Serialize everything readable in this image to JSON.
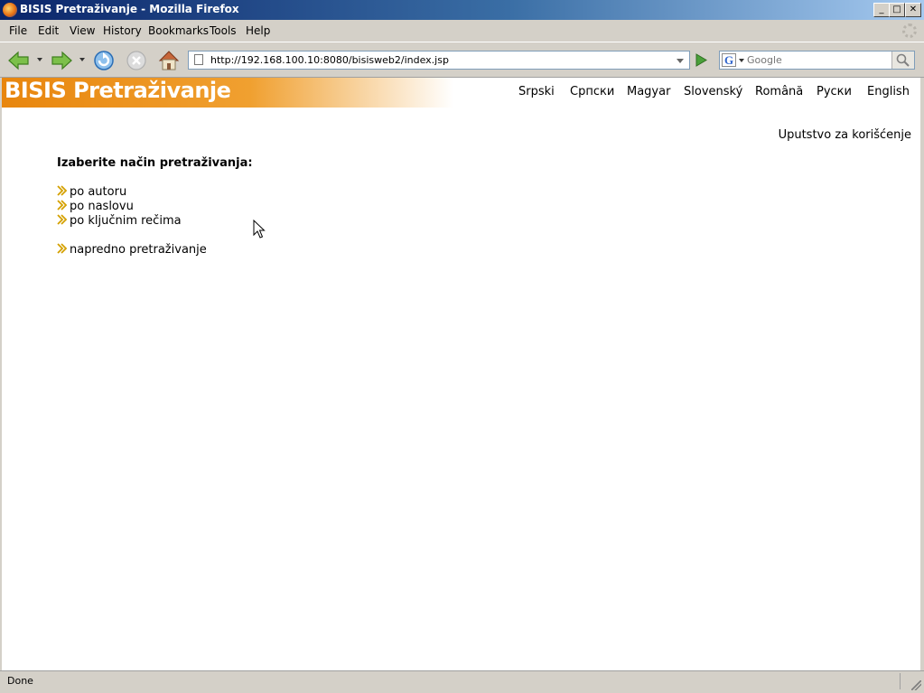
{
  "window": {
    "title": "BISIS Pretraživanje - Mozilla Firefox",
    "controls": {
      "minimize": "_",
      "maximize": "□",
      "close": "✕"
    }
  },
  "menu": {
    "items": [
      {
        "label": "File"
      },
      {
        "label": "Edit"
      },
      {
        "label": "View"
      },
      {
        "label": "History"
      },
      {
        "label": "Bookmarks"
      },
      {
        "label": "Tools"
      },
      {
        "label": "Help"
      }
    ]
  },
  "toolbar": {
    "icons": [
      "back-icon",
      "forward-icon",
      "reload-icon",
      "stop-icon",
      "home-icon",
      "go-icon",
      "search-icon"
    ],
    "url": "http://192.168.100.10:8080/bisisweb2/index.jsp",
    "search_placeholder": "Google",
    "search_engine_glyph": "G"
  },
  "page": {
    "banner_title": "BISIS Pretraživanje",
    "languages": [
      {
        "label": "Srpski"
      },
      {
        "label": "Српски"
      },
      {
        "label": "Magyar"
      },
      {
        "label": "Slovenský"
      },
      {
        "label": "Română"
      },
      {
        "label": "Руски"
      },
      {
        "label": "English"
      }
    ],
    "help_link": "Uputstvo za korišćenje",
    "heading": "Izaberite način pretraživanja:",
    "options": [
      {
        "label": "po autoru"
      },
      {
        "label": "po naslovu"
      },
      {
        "label": "po ključnim rečima"
      }
    ],
    "advanced": {
      "label": "napredno pretraživanje"
    },
    "colors": {
      "banner_orange": "#e8860e",
      "arrow_gold": "#d4a000"
    }
  },
  "status": {
    "text": "Done"
  }
}
